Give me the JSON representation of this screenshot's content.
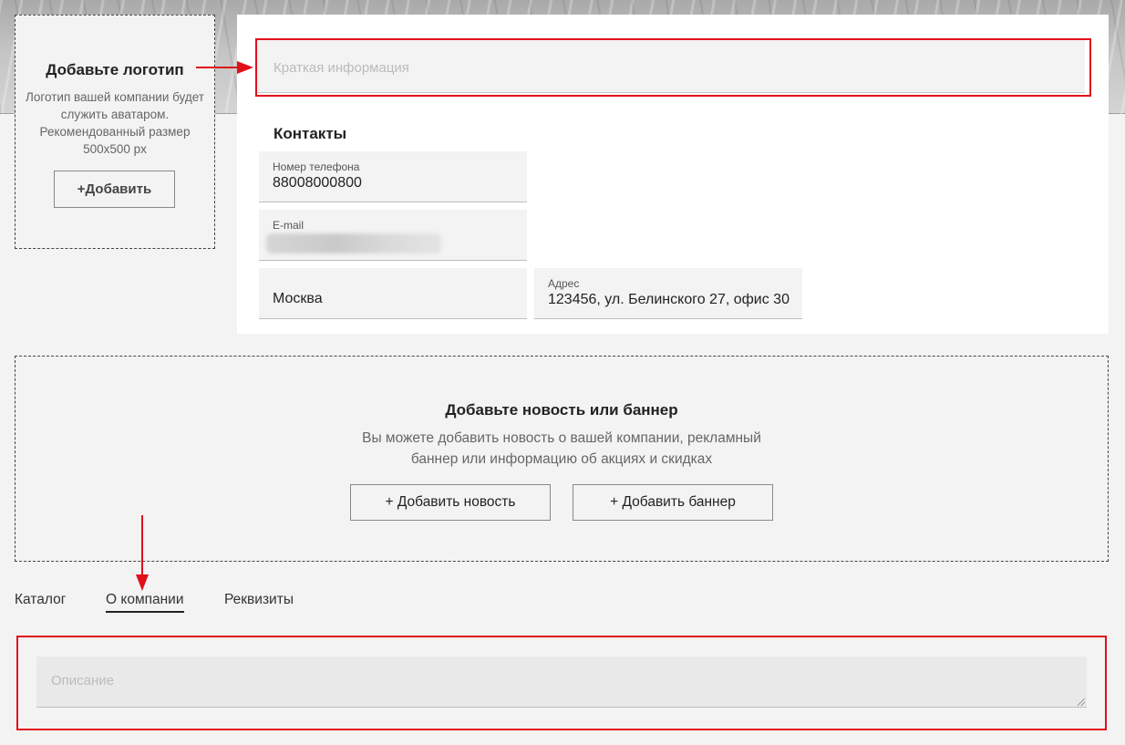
{
  "logo_box": {
    "title": "Добавьте логотип",
    "description": "Логотип вашей компании будет служить аватаром. Рекомендованный размер 500x500 px",
    "add_button": "+Добавить"
  },
  "info_card": {
    "short_info_placeholder": "Краткая информация",
    "contacts_title": "Контакты",
    "phone": {
      "label": "Номер телефона",
      "value": "88008000800"
    },
    "email": {
      "label": "E-mail"
    },
    "city": {
      "value": "Москва"
    },
    "address": {
      "label": "Адрес",
      "value": "123456, ул. Белинского 27, офис 30"
    }
  },
  "news_box": {
    "title": "Добавьте новость или баннер",
    "description_line1": "Вы можете добавить новость о вашей компании, рекламный",
    "description_line2": "баннер или информацию об акциях и скидках",
    "add_news_button": "+ Добавить новость",
    "add_banner_button": "+ Добавить баннер"
  },
  "tabs": [
    {
      "label": "Каталог",
      "active": false
    },
    {
      "label": "О компании",
      "active": true
    },
    {
      "label": "Реквизиты",
      "active": false
    }
  ],
  "description_placeholder": "Описание",
  "colors": {
    "annotation_red": "#e0101a",
    "card_white": "#ffffff",
    "page_bg": "#f3f3f3"
  }
}
